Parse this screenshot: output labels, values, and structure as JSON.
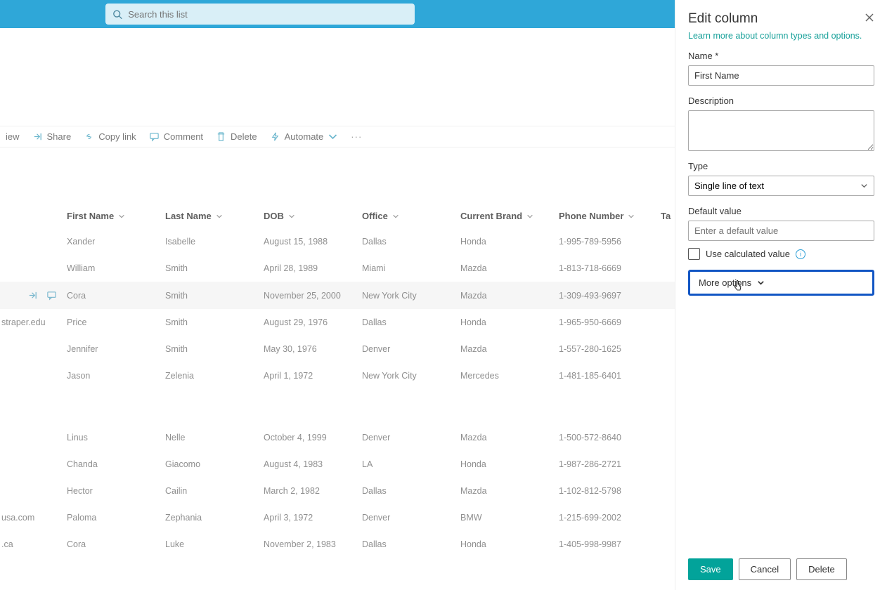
{
  "search": {
    "placeholder": "Search this list"
  },
  "commands": {
    "view": "iew",
    "share": "Share",
    "copylink": "Copy link",
    "comment": "Comment",
    "delete": "Delete",
    "automate": "Automate"
  },
  "columns": {
    "firstName": "First Name",
    "lastName": "Last Name",
    "dob": "DOB",
    "office": "Office",
    "currentBrand": "Current Brand",
    "phone": "Phone Number",
    "tag": "Ta"
  },
  "rows": [
    {
      "left": "",
      "first": "Xander",
      "last": "Isabelle",
      "dob": "August 15, 1988",
      "office": "Dallas",
      "brand": "Honda",
      "phone": "1-995-789-5956"
    },
    {
      "left": "",
      "first": "William",
      "last": "Smith",
      "dob": "April 28, 1989",
      "office": "Miami",
      "brand": "Mazda",
      "phone": "1-813-718-6669"
    },
    {
      "left": "",
      "first": "Cora",
      "last": "Smith",
      "dob": "November 25, 2000",
      "office": "New York City",
      "brand": "Mazda",
      "phone": "1-309-493-9697",
      "hover": true,
      "actions": true
    },
    {
      "left": "straper.edu",
      "first": "Price",
      "last": "Smith",
      "dob": "August 29, 1976",
      "office": "Dallas",
      "brand": "Honda",
      "phone": "1-965-950-6669"
    },
    {
      "left": "",
      "first": "Jennifer",
      "last": "Smith",
      "dob": "May 30, 1976",
      "office": "Denver",
      "brand": "Mazda",
      "phone": "1-557-280-1625"
    },
    {
      "left": "",
      "first": "Jason",
      "last": "Zelenia",
      "dob": "April 1, 1972",
      "office": "New York City",
      "brand": "Mercedes",
      "phone": "1-481-185-6401"
    }
  ],
  "rows2": [
    {
      "left": "",
      "first": "Linus",
      "last": "Nelle",
      "dob": "October 4, 1999",
      "office": "Denver",
      "brand": "Mazda",
      "phone": "1-500-572-8640"
    },
    {
      "left": "",
      "first": "Chanda",
      "last": "Giacomo",
      "dob": "August 4, 1983",
      "office": "LA",
      "brand": "Honda",
      "phone": "1-987-286-2721"
    },
    {
      "left": "",
      "first": "Hector",
      "last": "Cailin",
      "dob": "March 2, 1982",
      "office": "Dallas",
      "brand": "Mazda",
      "phone": "1-102-812-5798"
    },
    {
      "left": "usa.com",
      "first": "Paloma",
      "last": "Zephania",
      "dob": "April 3, 1972",
      "office": "Denver",
      "brand": "BMW",
      "phone": "1-215-699-2002"
    },
    {
      "left": ".ca",
      "first": "Cora",
      "last": "Luke",
      "dob": "November 2, 1983",
      "office": "Dallas",
      "brand": "Honda",
      "phone": "1-405-998-9987"
    }
  ],
  "panel": {
    "title": "Edit column",
    "learn": "Learn more about column types and options.",
    "nameLabel": "Name *",
    "nameValue": "First Name",
    "descLabel": "Description",
    "typeLabel": "Type",
    "typeValue": "Single line of text",
    "defaultLabel": "Default value",
    "defaultPlaceholder": "Enter a default value",
    "calcLabel": "Use calculated value",
    "moreOptions": "More options",
    "save": "Save",
    "cancel": "Cancel",
    "delete": "Delete"
  }
}
